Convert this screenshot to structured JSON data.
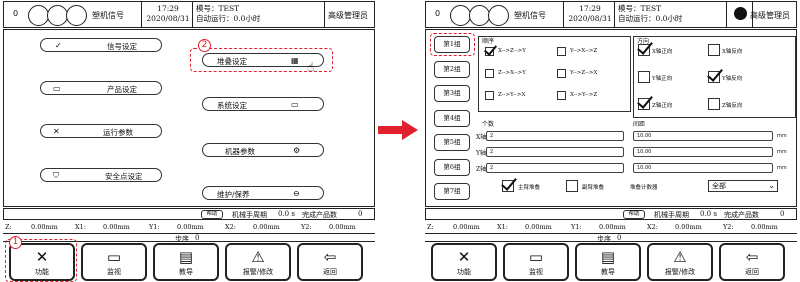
{
  "header": {
    "counter": "0",
    "signal_label": "塑机信号",
    "time": "17:29",
    "date": "2020/08/31",
    "mold": "模号：TEST",
    "auto_run": "自动运行：0.0小时",
    "user_role": "高级管理员"
  },
  "left_menu": {
    "signal_settings": "信号设定",
    "product_settings": "产品设定",
    "run_params": "运行参数",
    "safety_settings": "安全点设定",
    "stack_settings": "堆叠设定",
    "system_settings": "系统设定",
    "machine_params": "机器参数",
    "maintenance": "维护/保养"
  },
  "status": {
    "help": "帮助",
    "cycle_label": "机械手周期",
    "cycle_value": "0.0 s",
    "finished_label": "完成产品数",
    "finished_value": "0",
    "z_label": "Z:",
    "z_value": "0.00mm",
    "x1_label": "X1:",
    "x1_value": "0.00mm",
    "y1_label": "Y1:",
    "y1_value": "0.00mm",
    "x2_label": "X2:",
    "x2_value": "0.00mm",
    "y2_label": "Y2:",
    "y2_value": "0.00mm",
    "step_label": "步序",
    "step_value": "0"
  },
  "nav": {
    "function": "功能",
    "monitor": "监视",
    "teach": "教导",
    "alarm": "报警/修改",
    "back": "返回"
  },
  "steps": {
    "one": "1",
    "two": "2"
  },
  "stack": {
    "groups": [
      "第1组",
      "第2组",
      "第3组",
      "第4组",
      "第5组",
      "第6组",
      "第7组"
    ],
    "order_title": "顺序",
    "direction_title": "方向",
    "orders": [
      {
        "label": "X-->Z-->Y",
        "checked": true
      },
      {
        "label": "Y-->X-->Z",
        "checked": false
      },
      {
        "label": "Z-->X-->Y",
        "checked": false
      },
      {
        "label": "Y-->Z-->X",
        "checked": false
      },
      {
        "label": "Z-->Y-->X",
        "checked": false
      },
      {
        "label": "X-->Y-->Z",
        "checked": false
      }
    ],
    "directions": [
      {
        "label": "X轴正向",
        "checked": true
      },
      {
        "label": "X轴反向",
        "checked": false
      },
      {
        "label": "Y轴正向",
        "checked": false
      },
      {
        "label": "Y轴反向",
        "checked": true
      },
      {
        "label": "Z轴正向",
        "checked": true
      },
      {
        "label": "Z轴反向",
        "checked": false
      }
    ],
    "count_title": "个数",
    "spacing_title": "间距",
    "axes": [
      "X轴",
      "Y轴",
      "Z轴"
    ],
    "counts": [
      "2",
      "2",
      "2"
    ],
    "spacings": [
      "10.00",
      "10.00",
      "10.00"
    ],
    "unit": "mm",
    "main_stack_label": "主臂堆叠",
    "main_stack_checked": true,
    "sub_stack_label": "副臂堆叠",
    "sub_stack_checked": false,
    "counter_label": "堆叠计数器",
    "counter_value": "全部"
  },
  "colors": {
    "accent_red": "#e0202a"
  }
}
